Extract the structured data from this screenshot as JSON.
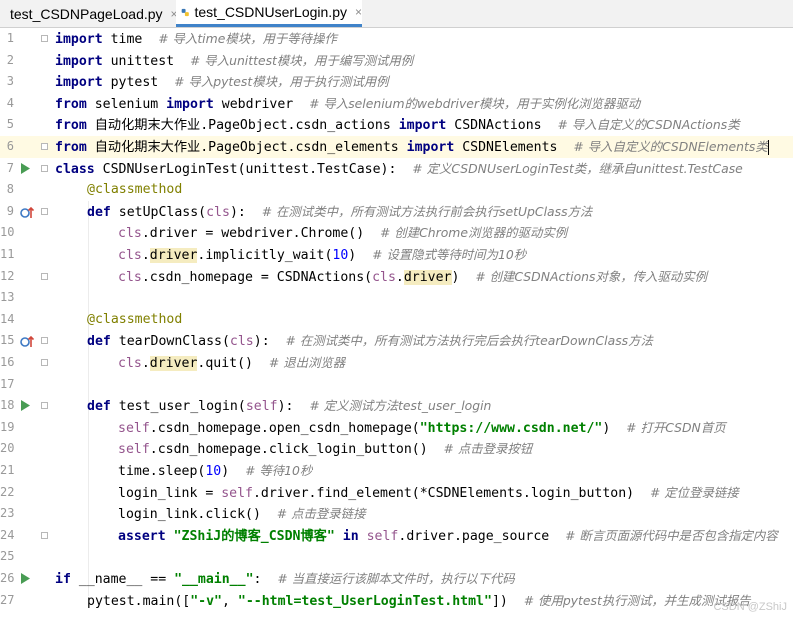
{
  "tabs": [
    {
      "label": "test_CSDNPageLoad.py",
      "active": false
    },
    {
      "label": "test_CSDNUserLogin.py",
      "active": true
    }
  ],
  "tab_close_glyph": "×",
  "icons": [
    "python-file-icon",
    "close-icon",
    "run-icon",
    "breakpoint-override-icon",
    "fold-icon"
  ],
  "colors": {
    "keyword": "#000080",
    "comment": "#808080",
    "string": "#008000",
    "number": "#0000ff",
    "self": "#94558d",
    "decorator": "#808000",
    "active_tab_underline": "#4083c9"
  },
  "line_numbers": [
    "1",
    "2",
    "3",
    "4",
    "5",
    "6",
    "7",
    "8",
    "9",
    "10",
    "11",
    "12",
    "13",
    "14",
    "15",
    "16",
    "17",
    "18",
    "19",
    "20",
    "21",
    "22",
    "23",
    "24",
    "25",
    "26",
    "27"
  ],
  "code": {
    "l1_a": "import",
    "l1_b": " time  ",
    "l1_c": "# 导入time模块，用于等待操作",
    "l2_a": "import",
    "l2_b": " unittest  ",
    "l2_c": "# 导入unittest模块，用于编写测试用例",
    "l3_a": "import",
    "l3_b": " pytest  ",
    "l3_c": "# 导入pytest模块，用于执行测试用例",
    "l4_a": "from",
    "l4_b": " selenium ",
    "l4_c": "import",
    "l4_d": " webdriver  ",
    "l4_e": "# 导入selenium的webdriver模块，用于实例化浏览器驱动",
    "l5_a": "from",
    "l5_b": " 自动化期末大作业.PageObject.csdn_actions ",
    "l5_c": "import",
    "l5_d": " CSDNActions  ",
    "l5_e": "# 导入自定义的CSDNActions类",
    "l6_a": "from",
    "l6_b": " 自动化期末大作业.PageObject.csdn_elements ",
    "l6_c": "import",
    "l6_d": " CSDNElements  ",
    "l6_e": "# 导入自定义的CSDNElements类",
    "l7_a": "class",
    "l7_b": " CSDNUserLoginTest(unittest.TestCase):  ",
    "l7_c": "# 定义CSDNUserLoginTest类，继承自unittest.TestCase",
    "l8_a": "@classmethod",
    "l9_a": "def",
    "l9_b": " setUpClass(",
    "l9_c": "cls",
    "l9_d": "):  ",
    "l9_e": "# 在测试类中，所有测试方法执行前会执行setUpClass方法",
    "l10_a": "cls",
    "l10_b": ".driver = webdriver.Chrome()  ",
    "l10_c": "# 创建Chrome浏览器的驱动实例",
    "l11_a": "cls",
    "l11_b": ".",
    "l11_c": "driver",
    "l11_d": ".implicitly_wait(",
    "l11_e": "10",
    "l11_f": ")  ",
    "l11_g": "# 设置隐式等待时间为10秒",
    "l12_a": "cls",
    "l12_b": ".csdn_homepage = CSDNActions(",
    "l12_c": "cls",
    "l12_d": ".",
    "l12_e": "driver",
    "l12_f": ")  ",
    "l12_g": "# 创建CSDNActions对象，传入驱动实例",
    "l14_a": "@classmethod",
    "l15_a": "def",
    "l15_b": " tearDownClass(",
    "l15_c": "cls",
    "l15_d": "):  ",
    "l15_e": "# 在测试类中，所有测试方法执行完后会执行tearDownClass方法",
    "l16_a": "cls",
    "l16_b": ".",
    "l16_c": "driver",
    "l16_d": ".quit()  ",
    "l16_e": "# 退出浏览器",
    "l18_a": "def",
    "l18_b": " test_user_login(",
    "l18_c": "self",
    "l18_d": "):  ",
    "l18_e": "# 定义测试方法test_user_login",
    "l19_a": "self",
    "l19_b": ".csdn_homepage.open_csdn_homepage(",
    "l19_c": "\"https://www.csdn.net/\"",
    "l19_d": ")  ",
    "l19_e": "# 打开CSDN首页",
    "l20_a": "self",
    "l20_b": ".csdn_homepage.click_login_button()  ",
    "l20_c": "# 点击登录按钮",
    "l21_a": "time.sleep(",
    "l21_b": "10",
    "l21_c": ")  ",
    "l21_d": "# 等待10秒",
    "l22_a": "login_link = ",
    "l22_b": "self",
    "l22_c": ".driver.find_element(*CSDNElements.login_button)  ",
    "l22_d": "# 定位登录链接",
    "l23_a": "login_link.click()  ",
    "l23_b": "# 点击登录链接",
    "l24_a": "assert",
    "l24_b": " ",
    "l24_c": "\"ZShiJ的博客_CSDN博客\"",
    "l24_d": " ",
    "l24_e": "in",
    "l24_f": " ",
    "l24_g": "self",
    "l24_h": ".driver.page_source  ",
    "l24_i": "# 断言页面源代码中是否包含指定内容",
    "l26_a": "if",
    "l26_b": " __name__ == ",
    "l26_c": "\"__main__\"",
    "l26_d": ":  ",
    "l26_e": "# 当直接运行该脚本文件时，执行以下代码",
    "l27_a": "pytest.main([",
    "l27_b": "\"-v\"",
    "l27_c": ", ",
    "l27_d": "\"--html=test_UserLoginTest.html\"",
    "l27_e": "])  ",
    "l27_f": "# 使用pytest执行测试，并生成测试报告"
  },
  "watermark": "CSDN @ZShiJ"
}
